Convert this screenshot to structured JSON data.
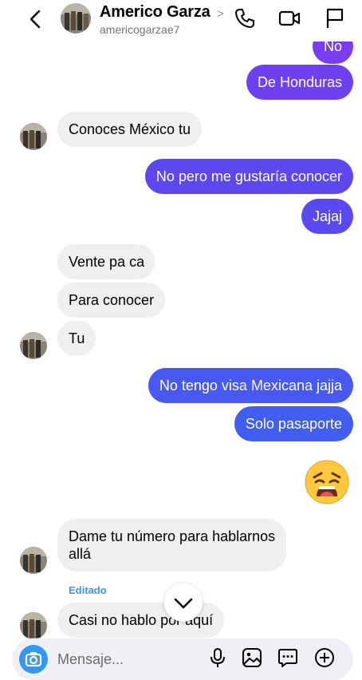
{
  "header": {
    "name": "Americo Garza",
    "chevron": ">",
    "username": "americogarzae7"
  },
  "messages": [
    {
      "dir": "out",
      "text": "No"
    },
    {
      "dir": "out",
      "text": "De Honduras"
    },
    {
      "dir": "in",
      "text": "Conoces México tu"
    },
    {
      "dir": "out",
      "text": "No pero me gustaría conocer"
    },
    {
      "dir": "out",
      "text": "Jajaj"
    },
    {
      "dir": "in",
      "text": "Vente pa ca"
    },
    {
      "dir": "in",
      "text": "Para conocer"
    },
    {
      "dir": "in",
      "text": "Tu"
    },
    {
      "dir": "out",
      "text": "No tengo visa Mexicana jajja"
    },
    {
      "dir": "out",
      "text": "Solo pasaporte"
    },
    {
      "dir": "out",
      "emoji": "weary-face"
    },
    {
      "dir": "in",
      "text_line1": "Dame tu número para hablarnos",
      "text_line2": "allá"
    },
    {
      "dir": "in",
      "label": "Editado",
      "text": "Casi no hablo por aquí"
    }
  ],
  "composer": {
    "placeholder": "Mensaje..."
  },
  "icons": {
    "back": "chevron-left-icon",
    "phone": "phone-icon",
    "video": "video-camera-icon",
    "flag": "flag-icon",
    "scroll": "chevron-down-icon",
    "camera": "camera-icon",
    "mic": "microphone-icon",
    "gallery": "image-icon",
    "sticker": "sticker-message-icon",
    "more": "plus-circle-icon"
  },
  "colors": {
    "outgoing_top": "#7a3df0",
    "outgoing_bottom": "#3f5ef0",
    "incoming": "#efefef",
    "accent": "#3797f0",
    "edited_label": "#3897f0"
  }
}
